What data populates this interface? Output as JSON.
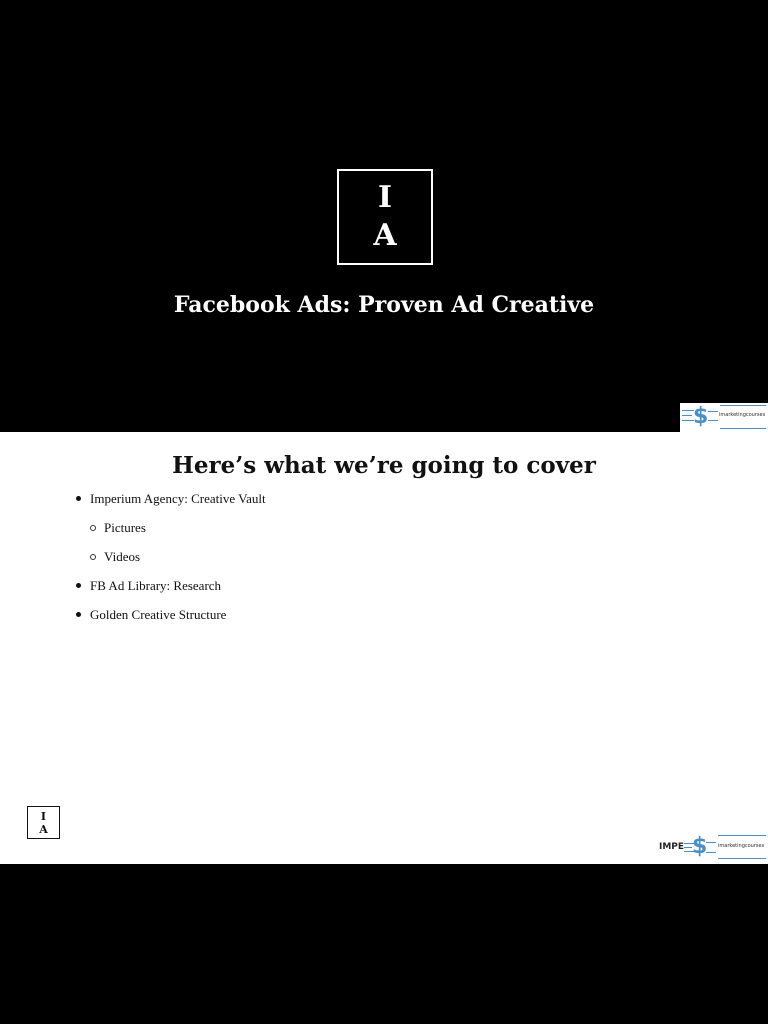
{
  "slide1": {
    "logo": {
      "line1": "I",
      "line2": "A"
    },
    "title": "Facebook Ads: Proven Ad Creative"
  },
  "watermark": {
    "brand": "imarketingcourses",
    "partial_text": "IMPE"
  },
  "slide2": {
    "title": "Here’s what we’re going to cover",
    "bullets": [
      {
        "text": "Imperium Agency: Creative Vault",
        "level": 1
      },
      {
        "text": "Pictures",
        "level": 2
      },
      {
        "text": "Videos",
        "level": 2
      },
      {
        "text": "FB Ad Library: Research",
        "level": 1
      },
      {
        "text": "Golden Creative Structure",
        "level": 1
      }
    ],
    "logo": {
      "line1": "I",
      "line2": "A"
    }
  },
  "colors": {
    "background": "#000000",
    "slide": "#ffffff",
    "watermark_accent": "#4a90c8"
  }
}
